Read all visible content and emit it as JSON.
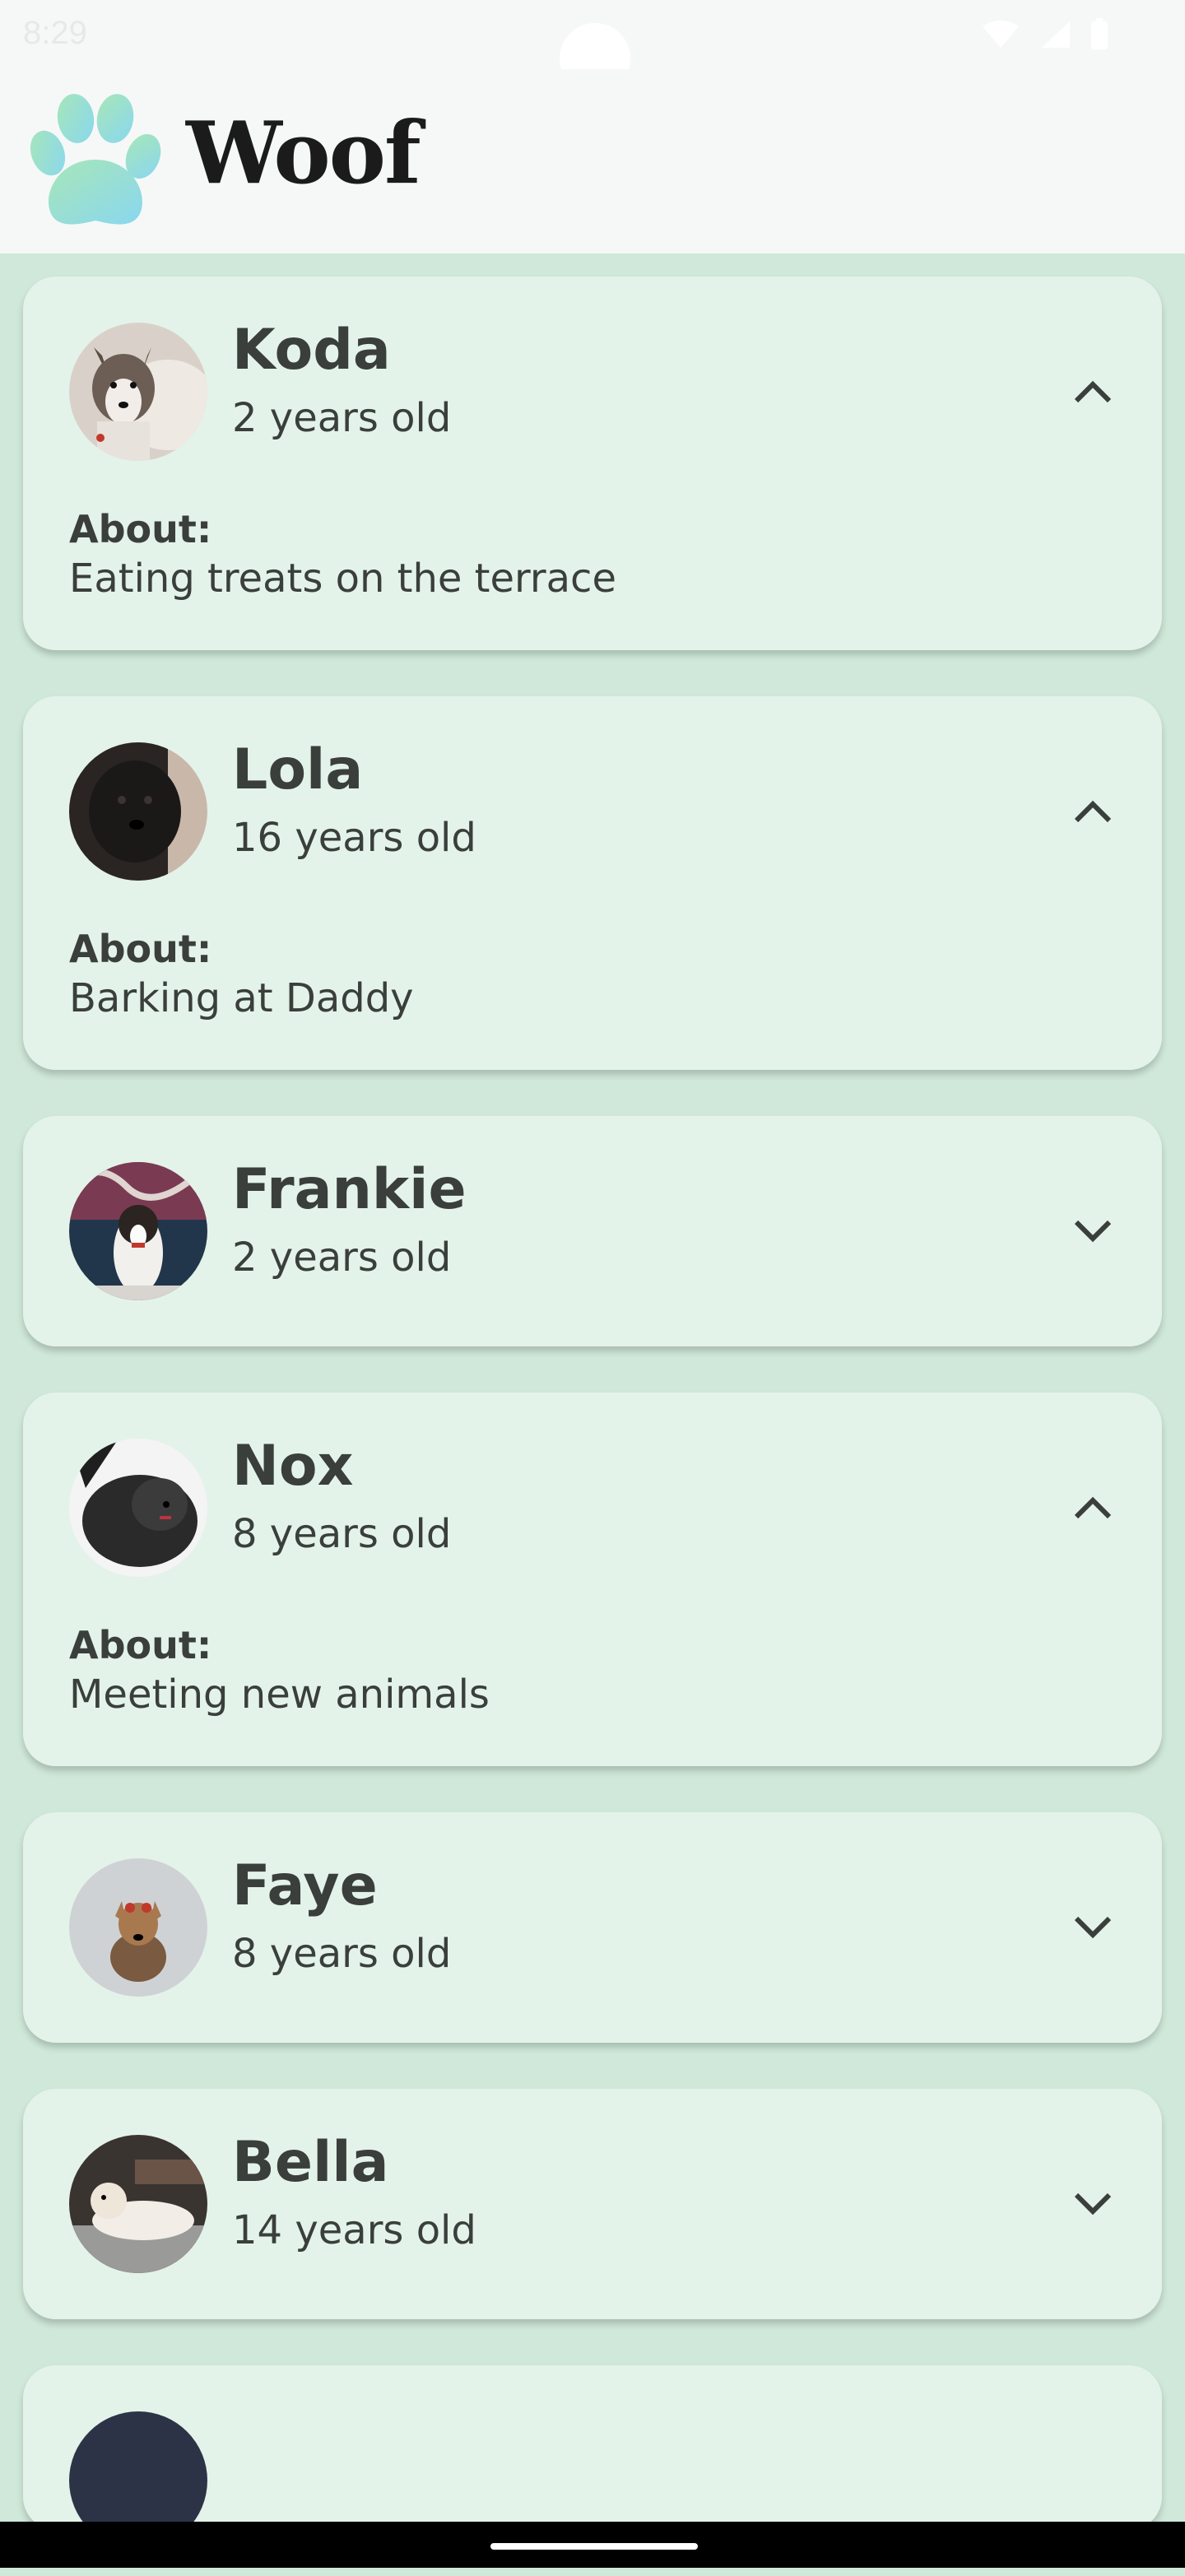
{
  "status_bar": {
    "time": "8:29"
  },
  "app_bar": {
    "title": "Woof",
    "logo_icon": "paw-icon"
  },
  "colors": {
    "background": "#cfe8d9",
    "card": "#e4f3e9",
    "text": "#3a3f3c"
  },
  "dogs": [
    {
      "name": "Koda",
      "age": "2 years old",
      "about_label": "About:",
      "about": "Eating treats on the terrace",
      "expanded": true
    },
    {
      "name": "Lola",
      "age": "16 years old",
      "about_label": "About:",
      "about": "Barking at Daddy",
      "expanded": true
    },
    {
      "name": "Frankie",
      "age": "2 years old",
      "expanded": false
    },
    {
      "name": "Nox",
      "age": "8 years old",
      "about_label": "About:",
      "about": "Meeting new animals",
      "expanded": true
    },
    {
      "name": "Faye",
      "age": "8 years old",
      "expanded": false
    },
    {
      "name": "Bella",
      "age": "14 years old",
      "expanded": false
    }
  ]
}
